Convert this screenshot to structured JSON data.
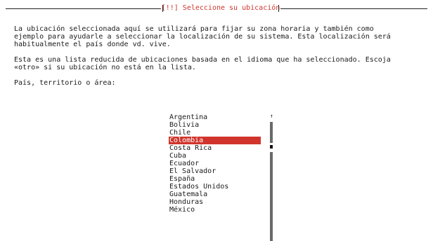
{
  "dialog": {
    "title": "[!!] Seleccione su ubicación",
    "description_lines": [
      "La ubicación seleccionada aquí se utilizará para fijar su zona horaria y también como",
      "ejemplo para ayudarle a seleccionar la localización de su sistema. Esta localización será",
      "habitualmente el país donde vd. vive."
    ],
    "note_lines": [
      "Esta es una lista reducida de ubicaciones basada en el idioma que ha seleccionado. Escoja",
      "«otro» si su ubicación no está en la lista."
    ],
    "prompt": "País, territorio o área:"
  },
  "country_list": {
    "selected": "Colombia",
    "items": [
      "Argentina",
      "Bolivia",
      "Chile",
      "Colombia",
      "Costa Rica",
      "Cuba",
      "Ecuador",
      "El Salvador",
      "España",
      "Estados Unidos",
      "Guatemala",
      "Honduras",
      "México"
    ]
  },
  "scrollbar": {
    "up_arrow": "↑"
  },
  "colors": {
    "accent": "#d0342c",
    "background": "#ffffff",
    "text": "#1a1a1a",
    "scroll_thumb": "#6a6a6a"
  }
}
